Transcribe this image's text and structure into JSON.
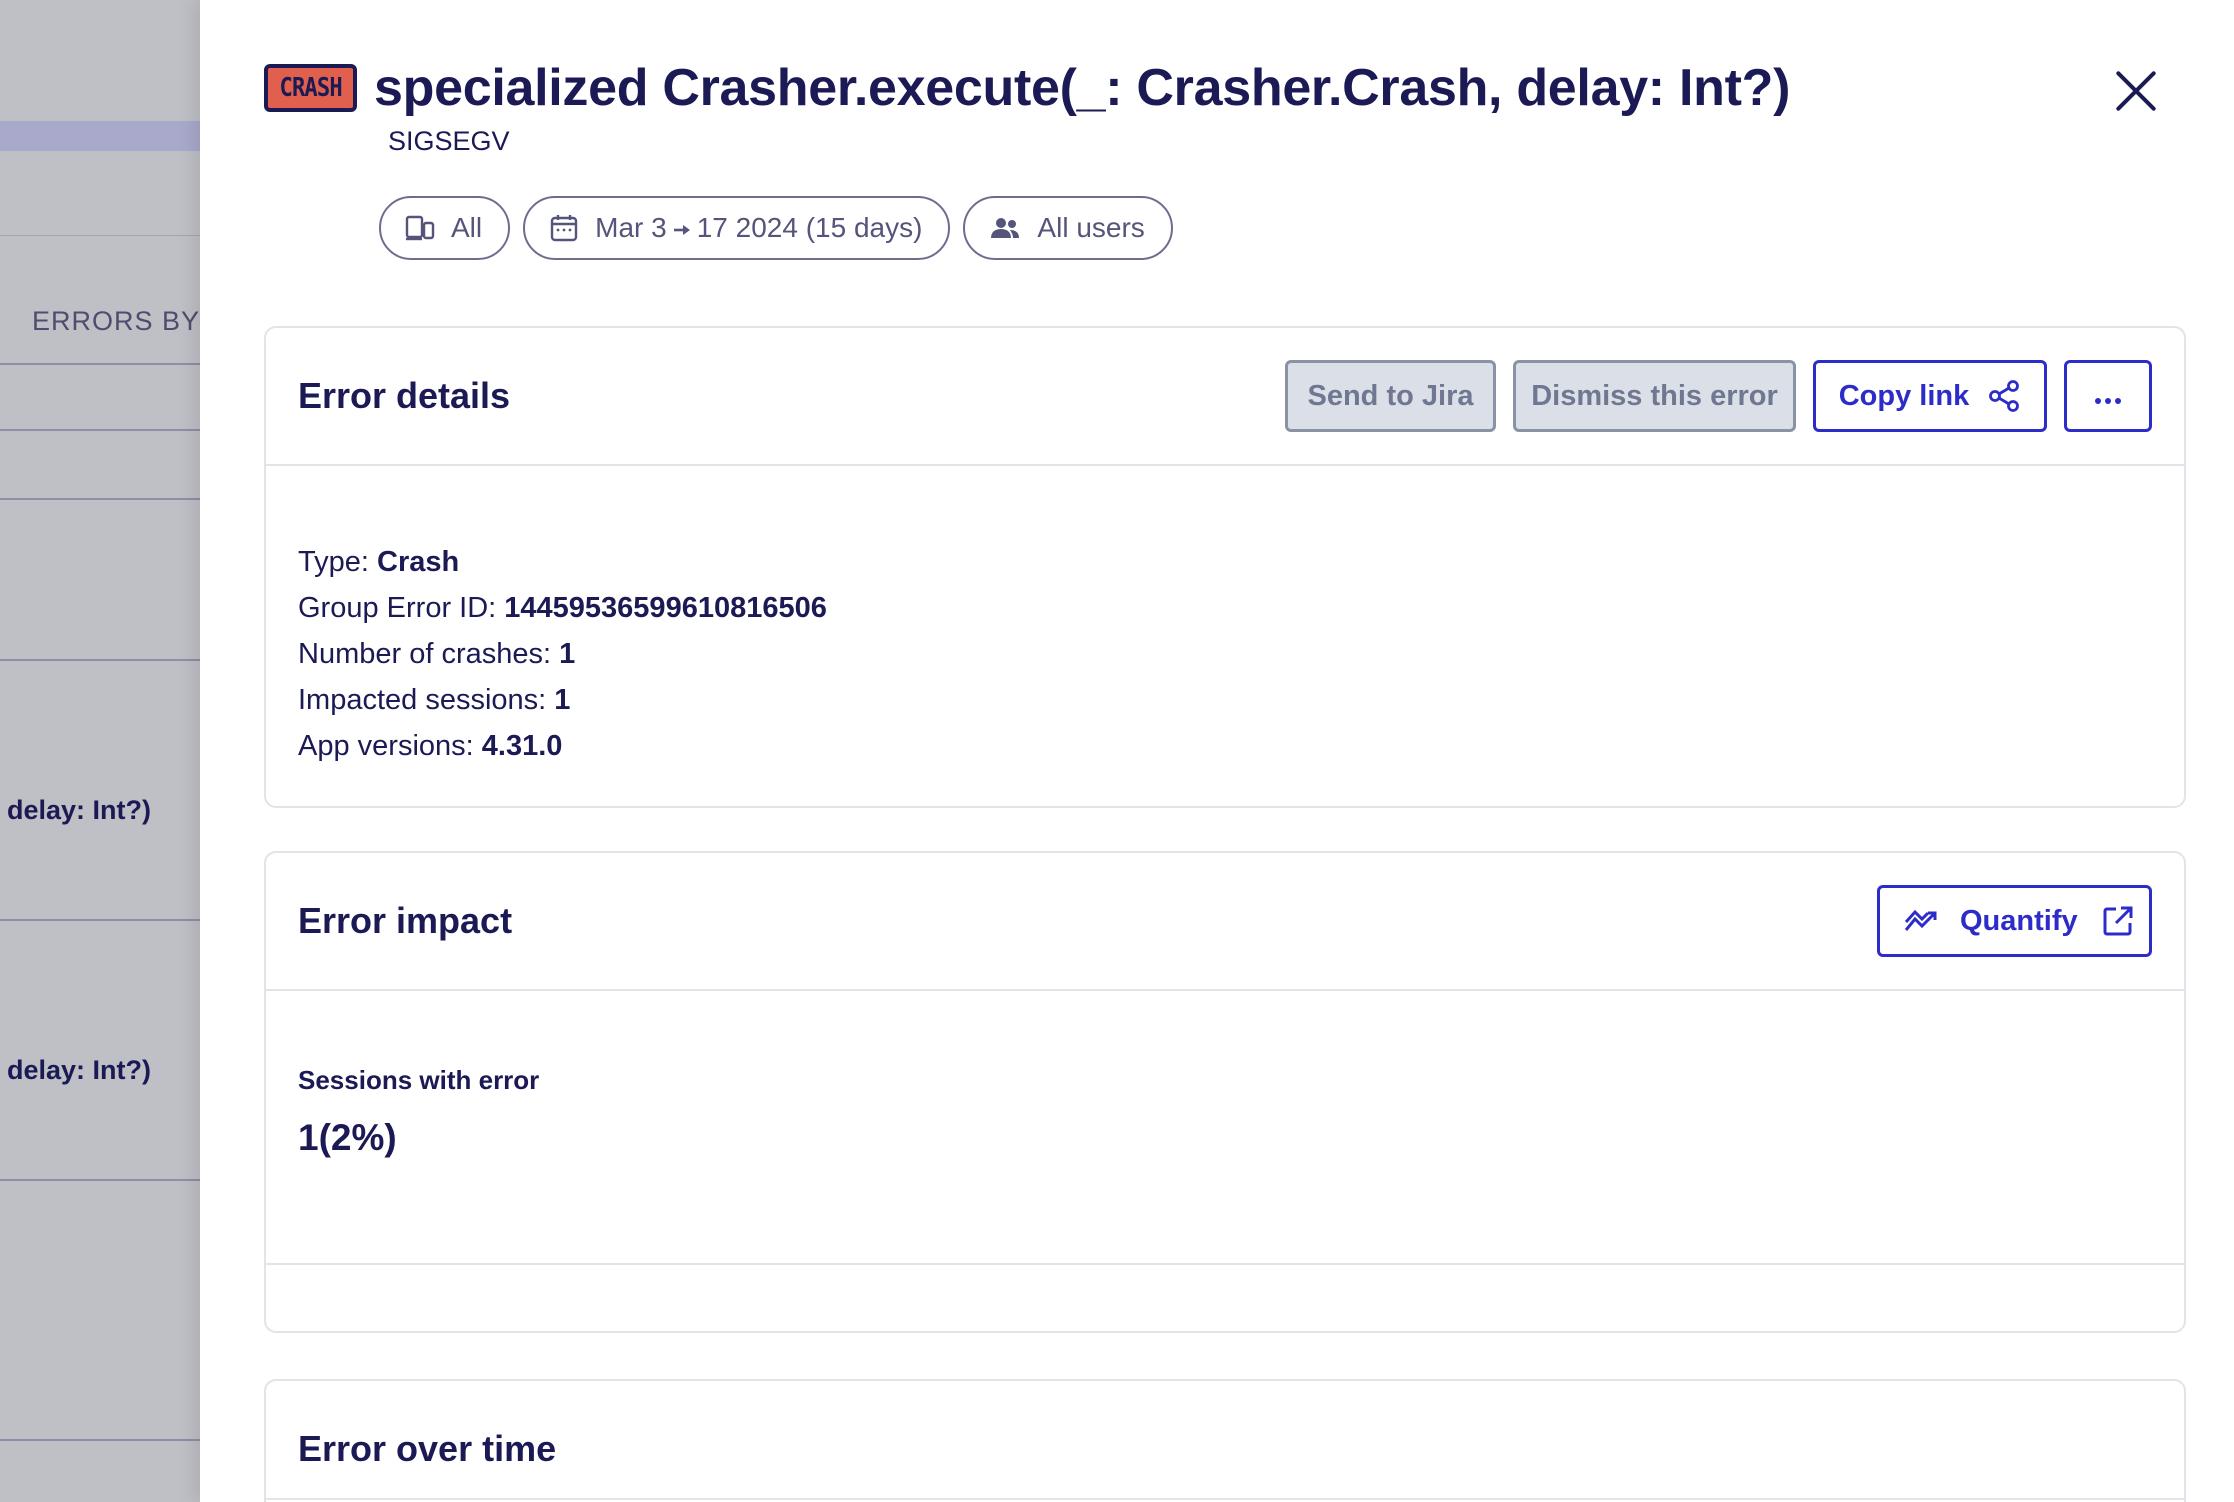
{
  "background": {
    "section_label": "ERRORS BY :",
    "rows": [
      "delay: Int?)",
      "delay: Int?)"
    ]
  },
  "drawer": {
    "badge_text": "CRASH",
    "title": "specialized Crasher.execute(_: Crasher.Crash, delay: Int?)",
    "subtitle": "SIGSEGV",
    "filters": {
      "device": "All",
      "date_start": "Mar 3",
      "date_end": "17 2024 (15 days)",
      "users": "All users"
    },
    "error_details": {
      "title": "Error details",
      "send_to_jira": "Send to Jira",
      "dismiss": "Dismiss this error",
      "copy_link": "Copy link",
      "more_icon": "ellipsis-icon",
      "fields": [
        {
          "label": "Type: ",
          "value": "Crash"
        },
        {
          "label": "Group Error ID: ",
          "value": "14459536599610816506"
        },
        {
          "label": "Number of crashes: ",
          "value": "1"
        },
        {
          "label": "Impacted sessions: ",
          "value": "1"
        },
        {
          "label": "App versions: ",
          "value": "4.31.0"
        }
      ]
    },
    "error_impact": {
      "title": "Error impact",
      "quantify": "Quantify",
      "sessions_label": "Sessions with error",
      "sessions_value": "1(2%)"
    },
    "error_over_time": {
      "title": "Error over time"
    },
    "colors": {
      "primary_text": "#1b1a55",
      "accent": "#2d2cc9",
      "crash_badge": "#e0604d"
    }
  }
}
